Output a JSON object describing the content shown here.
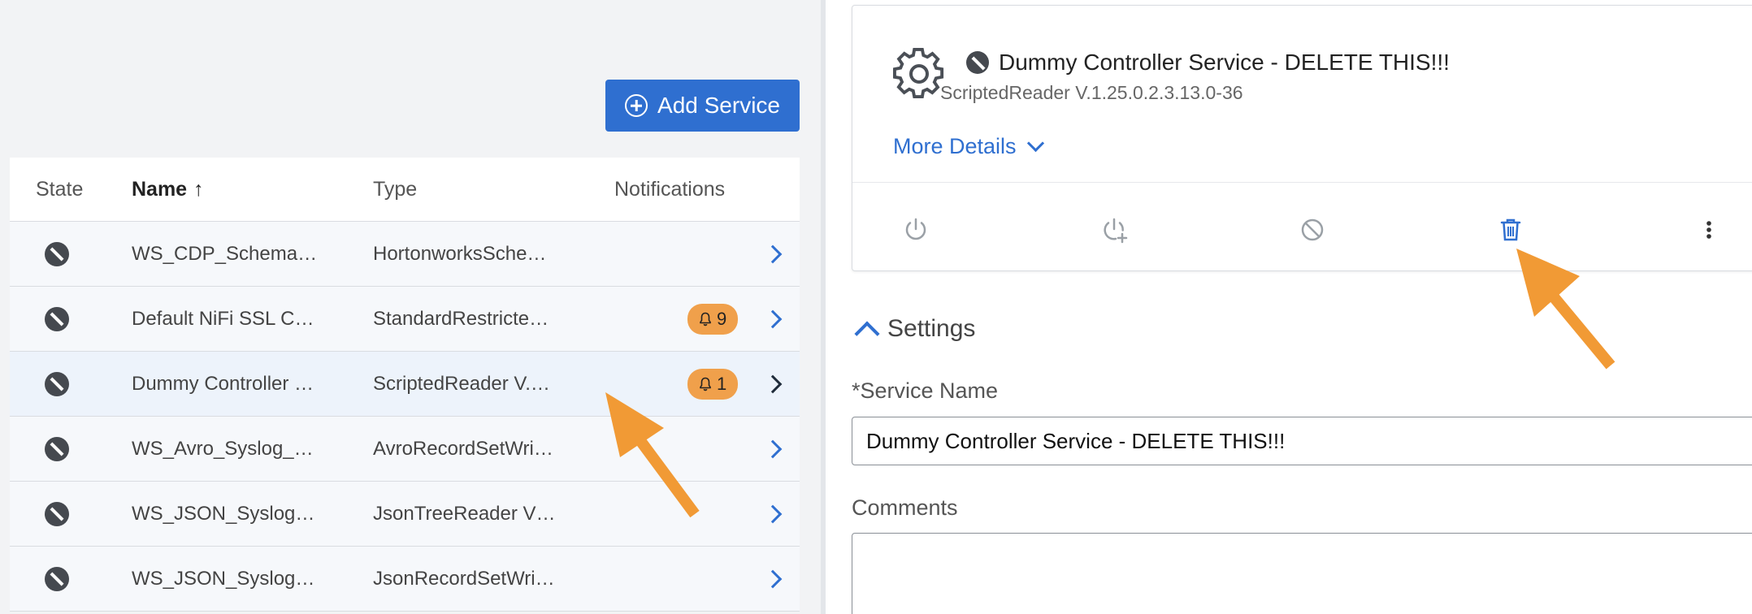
{
  "toolbar": {
    "add_service_label": "Add Service"
  },
  "table": {
    "headers": {
      "state": "State",
      "name": "Name",
      "type": "Type",
      "notifications": "Notifications"
    },
    "rows": [
      {
        "name": "WS_CDP_Schema…",
        "type": "HortonworksSche…",
        "notifications": ""
      },
      {
        "name": "Default NiFi SSL C…",
        "type": "StandardRestricte…",
        "notifications": "9"
      },
      {
        "name": "Dummy Controller …",
        "type": "ScriptedReader V.…",
        "notifications": "1"
      },
      {
        "name": "WS_Avro_Syslog_…",
        "type": "AvroRecordSetWri…",
        "notifications": ""
      },
      {
        "name": "WS_JSON_Syslog…",
        "type": "JsonTreeReader V…",
        "notifications": ""
      },
      {
        "name": "WS_JSON_Syslog…",
        "type": "JsonRecordSetWri…",
        "notifications": ""
      }
    ]
  },
  "detail": {
    "title": "Dummy Controller Service - DELETE THIS!!!",
    "subtitle": "ScriptedReader V.1.25.0.2.3.13.0-36",
    "more_details": "More Details",
    "actions": [
      "power-icon",
      "power-plus-icon",
      "disable-icon",
      "trash-icon",
      "more-vertical-icon"
    ]
  },
  "settings": {
    "heading": "Settings",
    "service_name_label": "*Service Name",
    "service_name_value": "Dummy Controller Service - DELETE THIS!!!",
    "comments_label": "Comments",
    "comments_value": ""
  },
  "colors": {
    "accent": "#2f6fd0",
    "badge": "#f0a04b",
    "annotation_arrow": "#f19a35"
  }
}
